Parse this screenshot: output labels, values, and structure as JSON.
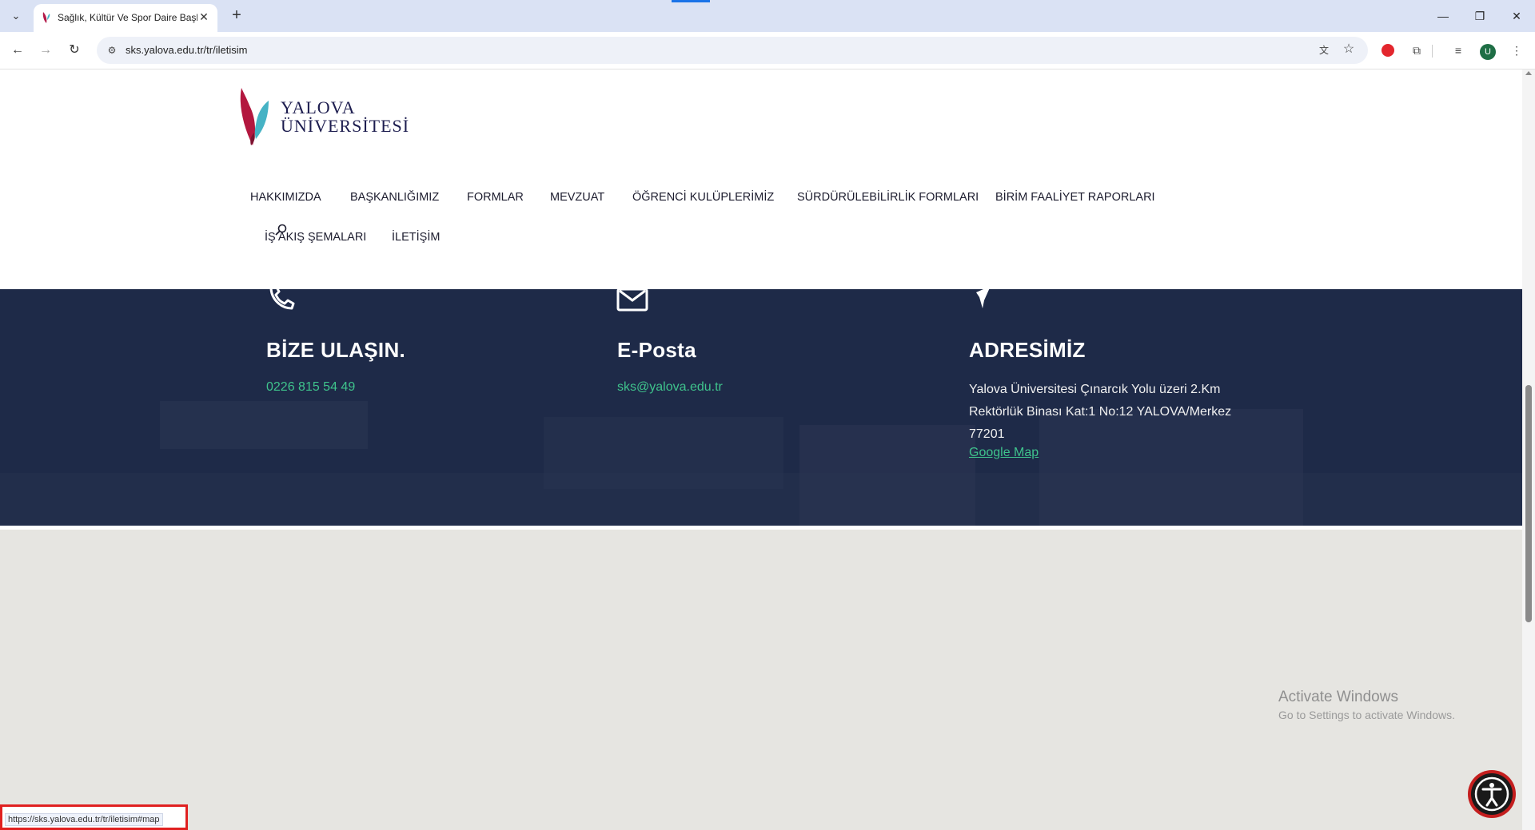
{
  "browser": {
    "tab_title": "Sağlık, Kültür Ve Spor Daire Başk",
    "url": "sks.yalova.edu.tr/tr/iletisim",
    "status_url": "https://sks.yalova.edu.tr/tr/iletisim#map",
    "profile_initial": "U"
  },
  "site": {
    "logo_line1": "YALOVA",
    "logo_line2": "ÜNİVERSİTESİ",
    "nav": [
      {
        "label": "HAKKIMIZDA"
      },
      {
        "label": "BAŞKANLIĞIMIZ"
      },
      {
        "label": "FORMLAR"
      },
      {
        "label": "MEVZUAT"
      },
      {
        "label": "ÖĞRENCİ KULÜPLERİMİZ"
      },
      {
        "label": "SÜRDÜRÜLEBİLİRLİK FORMLARI"
      },
      {
        "label": "BİRİM FAALİYET RAPORLARI"
      },
      {
        "label": "İŞ AKIŞ ŞEMALARI"
      },
      {
        "label": "İLETİŞİM"
      }
    ]
  },
  "contact": {
    "phone": {
      "heading": "BİZE ULAŞIN.",
      "value": "0226 815 54 49"
    },
    "email": {
      "heading": "E-Posta",
      "value": "sks@yalova.edu.tr"
    },
    "address": {
      "heading": "ADRESİMİZ",
      "text": "Yalova Üniversitesi Çınarcık Yolu üzeri 2.Km Rektörlük Binası Kat:1 No:12 YALOVA/Merkez 77201",
      "map_link": "Google Map"
    }
  },
  "system": {
    "activate_title": "Activate Windows",
    "activate_sub": "Go to Settings to activate Windows."
  },
  "colors": {
    "band": "#1e2a48",
    "link_green": "#3fc38c",
    "map_bg": "#e6e5e1"
  }
}
